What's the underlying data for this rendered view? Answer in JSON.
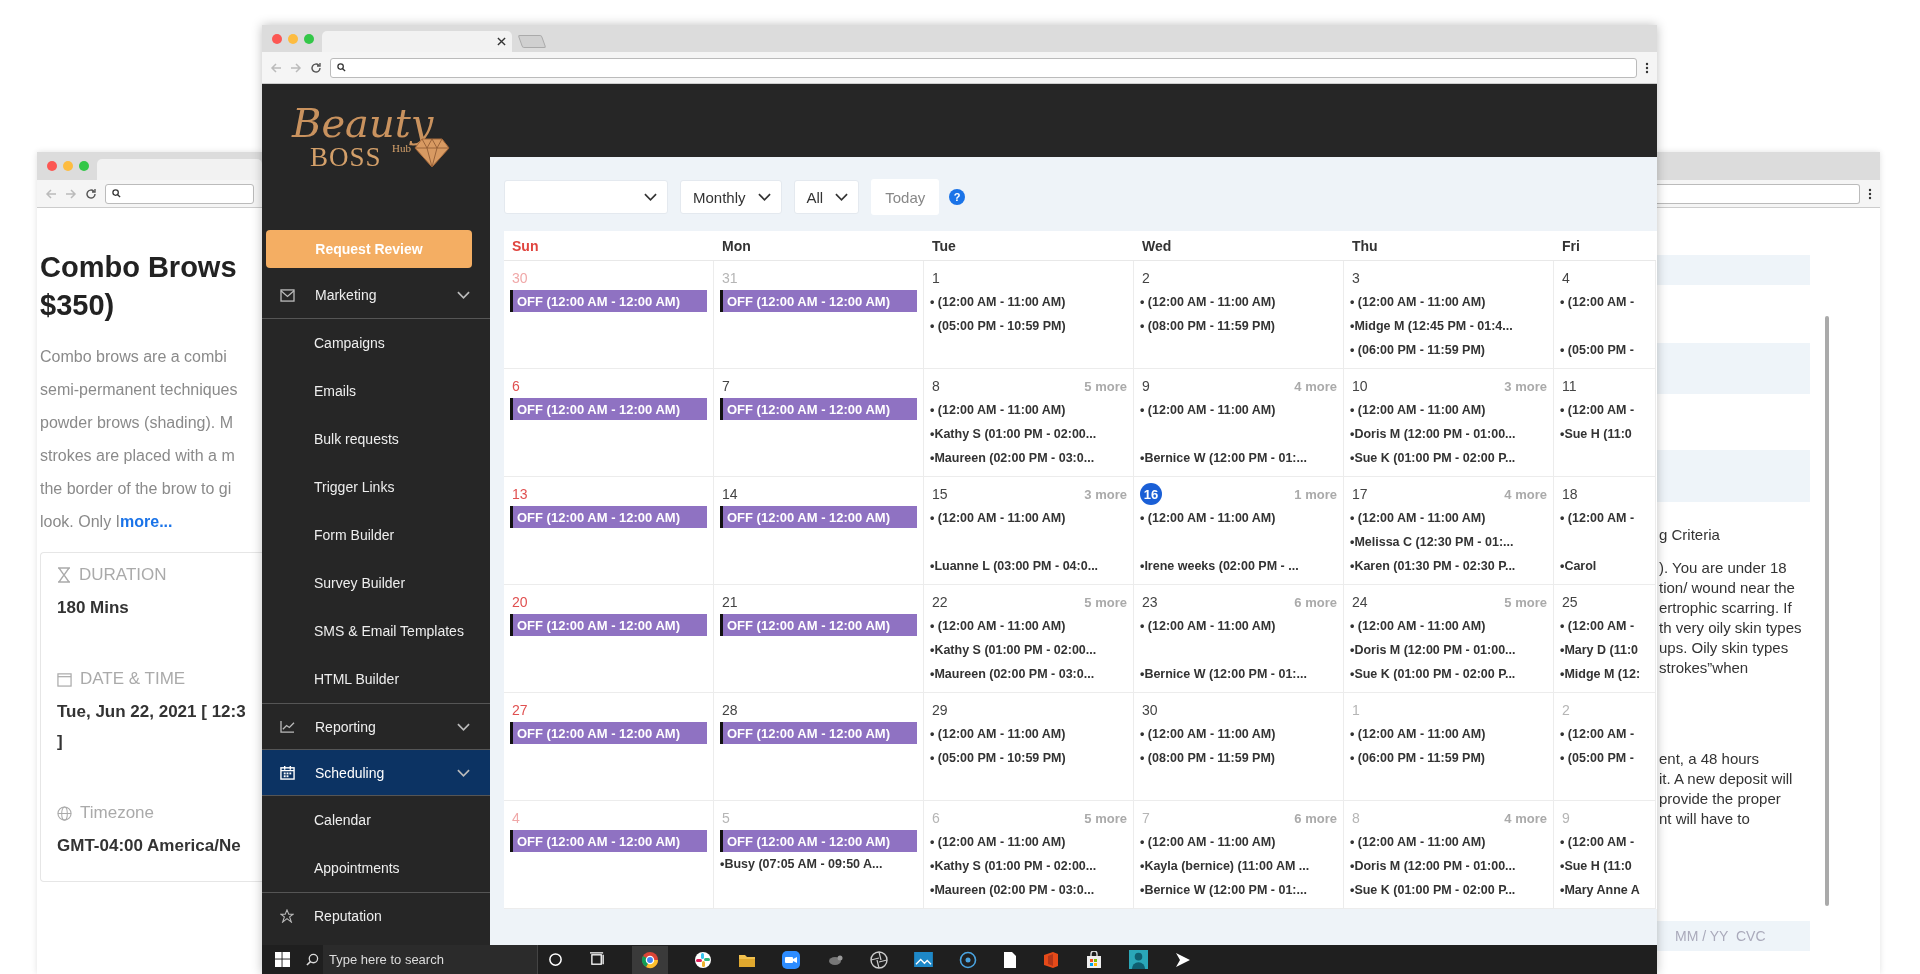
{
  "left_window": {
    "title_lines": [
      "Combo Brows",
      "$350)"
    ],
    "description_lines": [
      "Combo brows are a combi",
      "semi-permanent techniques",
      "powder brows (shading). M",
      "strokes are placed with a m",
      "the border of the brow to gi",
      "look. Only I"
    ],
    "more_link": "more...",
    "details": [
      {
        "label": "DURATION",
        "values": [
          "180 Mins"
        ]
      },
      {
        "label": "DATE & TIME",
        "values": [
          "Tue, Jun 22, 2021 [ 12:3",
          "]"
        ]
      },
      {
        "label": "Timezone",
        "values": [
          "GMT-04:00 America/Ne"
        ]
      }
    ]
  },
  "right_window": {
    "heading": "g Criteria",
    "paragraphs": [
      [
        "). You are under 18",
        "tion/ wound near the",
        "ertrophic scarring. If",
        "th very oily skin types",
        "ups. Oily skin types",
        "strokes”when"
      ],
      [
        "ent, a 48 hours",
        "it. A new deposit will",
        "provide the proper",
        "nt will have to"
      ]
    ],
    "card_field": {
      "placeholder": "MM / YY  CVC"
    }
  },
  "sidebar": {
    "logo": {
      "script": "Beauty",
      "main": "BOSS",
      "small": "Hub"
    },
    "request_button": "Request Review",
    "items": [
      {
        "label": "Marketing",
        "expandable": true,
        "selected": false,
        "children": [
          {
            "label": "Campaigns",
            "selected": false
          },
          {
            "label": "Emails",
            "selected": false
          },
          {
            "label": "Bulk requests",
            "selected": false
          },
          {
            "label": "Trigger Links",
            "selected": false
          },
          {
            "label": "Form Builder",
            "selected": false
          },
          {
            "label": "Survey Builder",
            "selected": false
          },
          {
            "label": "SMS & Email Templates",
            "selected": false
          },
          {
            "label": "HTML Builder",
            "selected": false
          }
        ]
      },
      {
        "label": "Reporting",
        "expandable": true,
        "selected": false
      },
      {
        "label": "Scheduling",
        "expandable": true,
        "selected": true,
        "children": [
          {
            "label": "Calendar",
            "selected": false
          },
          {
            "label": "Appointments",
            "selected": false
          }
        ]
      },
      {
        "label": "Reputation",
        "expandable": false,
        "selected": false
      }
    ]
  },
  "toolbar": {
    "selects": [
      {
        "kind": "blank"
      },
      {
        "kind": "text",
        "value": "Monthly"
      },
      {
        "kind": "text",
        "value": "All"
      }
    ],
    "today_button": "Today",
    "help": "?"
  },
  "calendar": {
    "weekdays": [
      {
        "label": "Sun",
        "weekend": true
      },
      {
        "label": "Mon",
        "weekend": false
      },
      {
        "label": "Tue",
        "weekend": false
      },
      {
        "label": "Wed",
        "weekend": false
      },
      {
        "label": "Thu",
        "weekend": false
      },
      {
        "label": "Fri",
        "weekend": false
      }
    ],
    "weeks": [
      [
        {
          "date": "30",
          "outside": true,
          "today": false,
          "events": [
            {
              "kind": "off",
              "text": "OFF (12:00 AM - 12:00 AM)"
            }
          ]
        },
        {
          "date": "31",
          "outside": true,
          "today": false,
          "events": [
            {
              "kind": "off",
              "text": "OFF (12:00 AM - 12:00 AM)"
            }
          ]
        },
        {
          "date": "1",
          "outside": false,
          "today": false,
          "events": [
            {
              "kind": "item",
              "text": "• (12:00 AM - 11:00 AM)"
            },
            {
              "kind": "item",
              "text": "• (05:00 PM - 10:59 PM)"
            }
          ]
        },
        {
          "date": "2",
          "outside": false,
          "today": false,
          "events": [
            {
              "kind": "item",
              "text": "• (12:00 AM - 11:00 AM)"
            },
            {
              "kind": "item",
              "text": "• (08:00 PM - 11:59 PM)"
            }
          ]
        },
        {
          "date": "3",
          "outside": false,
          "today": false,
          "events": [
            {
              "kind": "item",
              "text": "• (12:00 AM - 11:00 AM)"
            },
            {
              "kind": "item",
              "text": "•Midge M (12:45 PM - 01:4..."
            },
            {
              "kind": "item",
              "text": "• (06:00 PM - 11:59 PM)"
            }
          ]
        },
        {
          "date": "4",
          "outside": false,
          "today": false,
          "events": [
            {
              "kind": "item",
              "text": "• (12:00 AM -"
            },
            {
              "kind": "gap"
            },
            {
              "kind": "item",
              "text": "• (05:00 PM -"
            }
          ]
        }
      ],
      [
        {
          "date": "6",
          "outside": false,
          "today": false,
          "events": [
            {
              "kind": "off",
              "text": "OFF (12:00 AM - 12:00 AM)"
            }
          ]
        },
        {
          "date": "7",
          "outside": false,
          "today": false,
          "events": [
            {
              "kind": "off",
              "text": "OFF (12:00 AM - 12:00 AM)"
            }
          ]
        },
        {
          "date": "8",
          "outside": false,
          "today": false,
          "more": "5 more",
          "events": [
            {
              "kind": "item",
              "text": "• (12:00 AM - 11:00 AM)"
            },
            {
              "kind": "item",
              "text": "•Kathy S (01:00 PM - 02:00..."
            },
            {
              "kind": "item",
              "text": "•Maureen (02:00 PM - 03:0..."
            }
          ]
        },
        {
          "date": "9",
          "outside": false,
          "today": false,
          "more": "4 more",
          "events": [
            {
              "kind": "item",
              "text": "• (12:00 AM - 11:00 AM)"
            },
            {
              "kind": "gap"
            },
            {
              "kind": "item",
              "text": "•Bernice W (12:00 PM - 01:..."
            }
          ]
        },
        {
          "date": "10",
          "outside": false,
          "today": false,
          "more": "3 more",
          "events": [
            {
              "kind": "item",
              "text": "• (12:00 AM - 11:00 AM)"
            },
            {
              "kind": "item",
              "text": "•Doris M (12:00 PM - 01:00..."
            },
            {
              "kind": "item",
              "text": "•Sue K (01:00 PM - 02:00 P..."
            }
          ]
        },
        {
          "date": "11",
          "outside": false,
          "today": false,
          "events": [
            {
              "kind": "item",
              "text": "• (12:00 AM -"
            },
            {
              "kind": "item",
              "text": "•Sue H  (11:0"
            }
          ]
        }
      ],
      [
        {
          "date": "13",
          "outside": false,
          "today": false,
          "events": [
            {
              "kind": "off",
              "text": "OFF (12:00 AM - 12:00 AM)"
            }
          ]
        },
        {
          "date": "14",
          "outside": false,
          "today": false,
          "events": [
            {
              "kind": "off",
              "text": "OFF (12:00 AM - 12:00 AM)"
            }
          ]
        },
        {
          "date": "15",
          "outside": false,
          "today": false,
          "more": "3 more",
          "events": [
            {
              "kind": "item",
              "text": "• (12:00 AM - 11:00 AM)"
            },
            {
              "kind": "gap"
            },
            {
              "kind": "item",
              "text": "•Luanne L (03:00 PM - 04:0..."
            }
          ]
        },
        {
          "date": "16",
          "outside": false,
          "today": true,
          "more": "1 more",
          "events": [
            {
              "kind": "item",
              "text": "• (12:00 AM - 11:00 AM)"
            },
            {
              "kind": "gap"
            },
            {
              "kind": "item",
              "text": "•Irene weeks  (02:00 PM - ..."
            }
          ]
        },
        {
          "date": "17",
          "outside": false,
          "today": false,
          "more": "4 more",
          "events": [
            {
              "kind": "item",
              "text": "• (12:00 AM - 11:00 AM)"
            },
            {
              "kind": "item",
              "text": "•Melissa C (12:30 PM - 01:..."
            },
            {
              "kind": "item",
              "text": "•Karen (01:30 PM - 02:30 P..."
            }
          ]
        },
        {
          "date": "18",
          "outside": false,
          "today": false,
          "events": [
            {
              "kind": "item",
              "text": "• (12:00 AM -"
            },
            {
              "kind": "gap"
            },
            {
              "kind": "item",
              "text": "•Carol"
            }
          ]
        }
      ],
      [
        {
          "date": "20",
          "outside": false,
          "today": false,
          "events": [
            {
              "kind": "off",
              "text": "OFF (12:00 AM - 12:00 AM)"
            }
          ]
        },
        {
          "date": "21",
          "outside": false,
          "today": false,
          "events": [
            {
              "kind": "off",
              "text": "OFF (12:00 AM - 12:00 AM)"
            }
          ]
        },
        {
          "date": "22",
          "outside": false,
          "today": false,
          "more": "5 more",
          "events": [
            {
              "kind": "item",
              "text": "• (12:00 AM - 11:00 AM)"
            },
            {
              "kind": "item",
              "text": "•Kathy S (01:00 PM - 02:00..."
            },
            {
              "kind": "item",
              "text": "•Maureen (02:00 PM - 03:0..."
            }
          ]
        },
        {
          "date": "23",
          "outside": false,
          "today": false,
          "more": "6 more",
          "events": [
            {
              "kind": "item",
              "text": "• (12:00 AM - 11:00 AM)"
            },
            {
              "kind": "gap"
            },
            {
              "kind": "item",
              "text": "•Bernice W (12:00 PM - 01:..."
            }
          ]
        },
        {
          "date": "24",
          "outside": false,
          "today": false,
          "more": "5 more",
          "events": [
            {
              "kind": "item",
              "text": "• (12:00 AM - 11:00 AM)"
            },
            {
              "kind": "item",
              "text": "•Doris M (12:00 PM - 01:00..."
            },
            {
              "kind": "item",
              "text": "•Sue K (01:00 PM - 02:00 P..."
            }
          ]
        },
        {
          "date": "25",
          "outside": false,
          "today": false,
          "events": [
            {
              "kind": "item",
              "text": "• (12:00 AM -"
            },
            {
              "kind": "item",
              "text": "•Mary D (11:0"
            },
            {
              "kind": "item",
              "text": "•Midge M (12:"
            }
          ]
        }
      ],
      [
        {
          "date": "27",
          "outside": false,
          "today": false,
          "events": [
            {
              "kind": "off",
              "text": "OFF (12:00 AM - 12:00 AM)"
            }
          ]
        },
        {
          "date": "28",
          "outside": false,
          "today": false,
          "events": [
            {
              "kind": "off",
              "text": "OFF (12:00 AM - 12:00 AM)"
            }
          ]
        },
        {
          "date": "29",
          "outside": false,
          "today": false,
          "events": [
            {
              "kind": "item",
              "text": "• (12:00 AM - 11:00 AM)"
            },
            {
              "kind": "item",
              "text": "• (05:00 PM - 10:59 PM)"
            }
          ]
        },
        {
          "date": "30",
          "outside": false,
          "today": false,
          "events": [
            {
              "kind": "item",
              "text": "• (12:00 AM - 11:00 AM)"
            },
            {
              "kind": "item",
              "text": "• (08:00 PM - 11:59 PM)"
            }
          ]
        },
        {
          "date": "1",
          "outside": true,
          "today": false,
          "events": [
            {
              "kind": "item",
              "text": "• (12:00 AM - 11:00 AM)"
            },
            {
              "kind": "item",
              "text": "• (06:00 PM - 11:59 PM)"
            }
          ]
        },
        {
          "date": "2",
          "outside": true,
          "today": false,
          "events": [
            {
              "kind": "item",
              "text": "• (12:00 AM -"
            },
            {
              "kind": "item",
              "text": "• (05:00 PM -"
            }
          ]
        }
      ],
      [
        {
          "date": "4",
          "outside": true,
          "today": false,
          "events": [
            {
              "kind": "off",
              "text": "OFF (12:00 AM - 12:00 AM)"
            }
          ]
        },
        {
          "date": "5",
          "outside": true,
          "today": false,
          "events": [
            {
              "kind": "off",
              "text": "OFF (12:00 AM - 12:00 AM)"
            },
            {
              "kind": "item",
              "text": "•Busy (07:05 AM - 09:50 A..."
            }
          ]
        },
        {
          "date": "6",
          "outside": true,
          "today": false,
          "more": "5 more",
          "events": [
            {
              "kind": "item",
              "text": "• (12:00 AM - 11:00 AM)"
            },
            {
              "kind": "item",
              "text": "•Kathy S (01:00 PM - 02:00..."
            },
            {
              "kind": "item",
              "text": "•Maureen (02:00 PM - 03:0..."
            }
          ]
        },
        {
          "date": "7",
          "outside": true,
          "today": false,
          "more": "6 more",
          "events": [
            {
              "kind": "item",
              "text": "• (12:00 AM - 11:00 AM)"
            },
            {
              "kind": "item",
              "text": "•Kayla (bernice) (11:00 AM ..."
            },
            {
              "kind": "item",
              "text": "•Bernice W (12:00 PM - 01:..."
            }
          ]
        },
        {
          "date": "8",
          "outside": true,
          "today": false,
          "more": "4 more",
          "events": [
            {
              "kind": "item",
              "text": "• (12:00 AM - 11:00 AM)"
            },
            {
              "kind": "item",
              "text": "•Doris M (12:00 PM - 01:00..."
            },
            {
              "kind": "item",
              "text": "•Sue K (01:00 PM - 02:00 P..."
            }
          ]
        },
        {
          "date": "9",
          "outside": true,
          "today": false,
          "events": [
            {
              "kind": "item",
              "text": "• (12:00 AM -"
            },
            {
              "kind": "item",
              "text": "•Sue H  (11:0"
            },
            {
              "kind": "item",
              "text": "•Mary Anne A"
            }
          ]
        }
      ]
    ]
  },
  "taskbar": {
    "search": {
      "placeholder": "Type here to search"
    }
  }
}
